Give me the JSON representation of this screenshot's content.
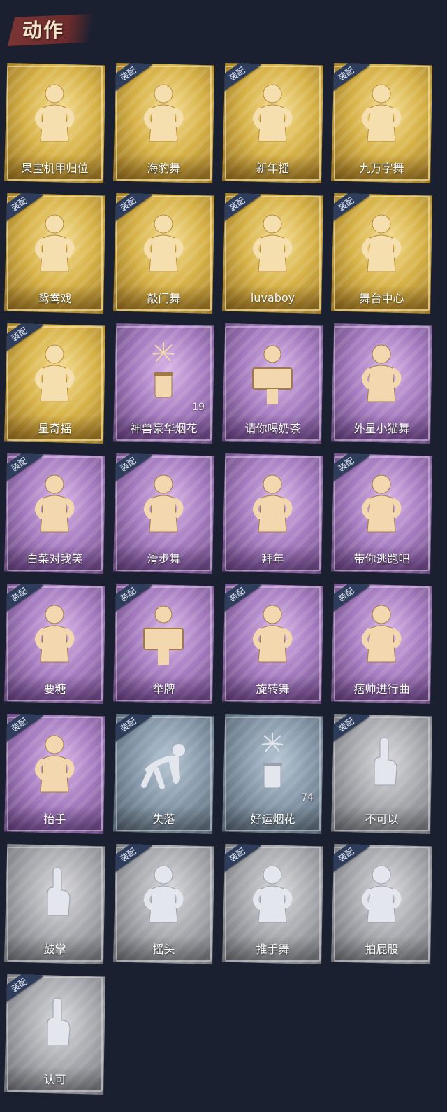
{
  "section_title": "动作",
  "equip_label": "装配",
  "colors": {
    "gold": "#d7b247",
    "purple": "#a57cc0",
    "blue": "#8597a8",
    "gray": "#a8a9ae",
    "background": "#1b2030"
  },
  "cards": [
    {
      "label": "果宝机甲归位",
      "rarity": "gold",
      "equipped": false,
      "icon": "dance-pose-icon",
      "count": ""
    },
    {
      "label": "海豹舞",
      "rarity": "gold",
      "equipped": true,
      "icon": "dance-pose-icon",
      "count": ""
    },
    {
      "label": "新年摇",
      "rarity": "gold",
      "equipped": true,
      "icon": "dance-pose-icon",
      "count": ""
    },
    {
      "label": "九万字舞",
      "rarity": "gold",
      "equipped": true,
      "icon": "dance-pose-icon",
      "count": ""
    },
    {
      "label": "鸳鸯戏",
      "rarity": "gold",
      "equipped": true,
      "icon": "dance-pose-icon",
      "count": ""
    },
    {
      "label": "敲门舞",
      "rarity": "gold",
      "equipped": true,
      "icon": "dance-pose-icon",
      "count": ""
    },
    {
      "label": "luvaboy",
      "rarity": "gold",
      "equipped": true,
      "icon": "dance-pose-icon",
      "count": ""
    },
    {
      "label": "舞台中心",
      "rarity": "gold",
      "equipped": true,
      "icon": "dance-pose-icon",
      "count": ""
    },
    {
      "label": "星奇摇",
      "rarity": "gold",
      "equipped": true,
      "icon": "dance-pose-icon",
      "count": ""
    },
    {
      "label": "神兽豪华烟花",
      "rarity": "purple",
      "equipped": false,
      "icon": "fireworks-icon",
      "count": "19"
    },
    {
      "label": "请你喝奶茶",
      "rarity": "purple",
      "equipped": false,
      "icon": "sign-board-icon",
      "count": ""
    },
    {
      "label": "外星小猫舞",
      "rarity": "purple",
      "equipped": false,
      "icon": "dance-pose-icon",
      "count": ""
    },
    {
      "label": "白菜对我笑",
      "rarity": "purple",
      "equipped": true,
      "icon": "dance-pose-icon",
      "count": ""
    },
    {
      "label": "滑步舞",
      "rarity": "purple",
      "equipped": true,
      "icon": "dance-pose-icon",
      "count": ""
    },
    {
      "label": "拜年",
      "rarity": "purple",
      "equipped": false,
      "icon": "bow-pose-icon",
      "count": ""
    },
    {
      "label": "带你逃跑吧",
      "rarity": "purple",
      "equipped": true,
      "icon": "dance-pose-icon",
      "count": ""
    },
    {
      "label": "要糖",
      "rarity": "purple",
      "equipped": true,
      "icon": "reach-pose-icon",
      "count": ""
    },
    {
      "label": "举牌",
      "rarity": "purple",
      "equipped": true,
      "icon": "sign-board-icon",
      "count": ""
    },
    {
      "label": "旋转舞",
      "rarity": "purple",
      "equipped": true,
      "icon": "spin-pose-icon",
      "count": ""
    },
    {
      "label": "痞帅进行曲",
      "rarity": "purple",
      "equipped": true,
      "icon": "dance-pose-icon",
      "count": ""
    },
    {
      "label": "抬手",
      "rarity": "purple",
      "equipped": true,
      "icon": "raise-hand-icon",
      "count": ""
    },
    {
      "label": "失落",
      "rarity": "blue",
      "equipped": true,
      "icon": "crawl-pose-icon",
      "count": ""
    },
    {
      "label": "好运烟花",
      "rarity": "blue",
      "equipped": false,
      "icon": "fireworks-can-icon",
      "count": "74"
    },
    {
      "label": "不可以",
      "rarity": "gray",
      "equipped": true,
      "icon": "finger-wag-icon",
      "count": ""
    },
    {
      "label": "鼓掌",
      "rarity": "gray",
      "equipped": false,
      "icon": "clap-icon",
      "count": ""
    },
    {
      "label": "摇头",
      "rarity": "gray",
      "equipped": true,
      "icon": "head-shake-icon",
      "count": ""
    },
    {
      "label": "推手舞",
      "rarity": "gray",
      "equipped": true,
      "icon": "push-hands-icon",
      "count": ""
    },
    {
      "label": "拍屁股",
      "rarity": "gray",
      "equipped": true,
      "icon": "pat-icon",
      "count": ""
    },
    {
      "label": "认可",
      "rarity": "gray",
      "equipped": true,
      "icon": "thumbs-up-icon",
      "count": ""
    }
  ]
}
